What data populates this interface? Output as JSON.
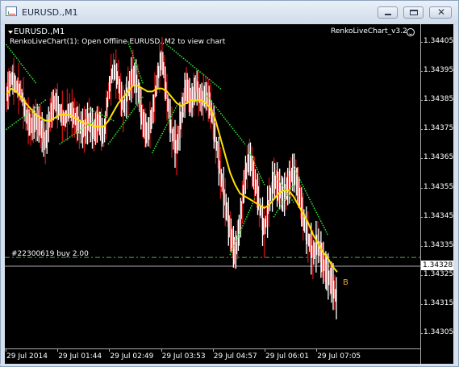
{
  "window": {
    "title": "EURUSD.,M1",
    "icon": "chart-window-icon",
    "controls": [
      "minimize-icon",
      "maximize-icon",
      "close-icon"
    ]
  },
  "chart_overlay": {
    "symbol_label": "EURUSD.,M1",
    "info_text": "RenkoLiveChart(1): Open Offline EURUSD.,M2 to view chart",
    "indicator_name": "RenkoLiveChart_v3.2",
    "order_label": "#22300619 buy 2.00",
    "trade_marker": "B",
    "current_price_tag": "1.34328"
  },
  "colors": {
    "background": "#000000",
    "bull_candle": "#ffffff",
    "bear_candle": "#cc1111",
    "moving_average": "#ffe000",
    "band_dots": "#33dd33",
    "order_line": "#55aa55",
    "current_price_line": "#aaaaaa",
    "trade_marker": "#e9a23b"
  },
  "chart_data": {
    "type": "line",
    "price_ticks": [
      "1.34405",
      "1.34395",
      "1.34385",
      "1.34375",
      "1.34365",
      "1.34355",
      "1.34345",
      "1.34335",
      "1.34325",
      "1.34315",
      "1.34305"
    ],
    "time_ticks": [
      "29 Jul 2014",
      "29 Jul 01:44",
      "29 Jul 02:49",
      "29 Jul 03:53",
      "29 Jul 04:57",
      "29 Jul 06:01",
      "29 Jul 07:05"
    ],
    "ylim": [
      1.34301,
      1.34408
    ],
    "order_price": 1.34331,
    "current_price": 1.34328,
    "series": [
      {
        "name": "Price",
        "values": [
          1.34386,
          1.34393,
          1.3439,
          1.34388,
          1.3438,
          1.34376,
          1.34378,
          1.34376,
          1.3437,
          1.3438,
          1.34385,
          1.34381,
          1.34378,
          1.34382,
          1.34379,
          1.34376,
          1.34375,
          1.34378,
          1.34374,
          1.34378,
          1.34372,
          1.34388,
          1.34396,
          1.34392,
          1.34382,
          1.34388,
          1.34394,
          1.3439,
          1.34378,
          1.34373,
          1.3438,
          1.34392,
          1.344,
          1.34386,
          1.34374,
          1.34368,
          1.3438,
          1.3439,
          1.34384,
          1.3439,
          1.34385,
          1.34387,
          1.34383,
          1.34372,
          1.3436,
          1.3435,
          1.3434,
          1.34332,
          1.34342,
          1.34358,
          1.34366,
          1.34358,
          1.3435,
          1.3434,
          1.3435,
          1.34358,
          1.34355,
          1.34352,
          1.34356,
          1.34361,
          1.34355,
          1.34345,
          1.34338,
          1.34332,
          1.34336,
          1.3433,
          1.34325,
          1.34322,
          1.34316
        ]
      },
      {
        "name": "MA",
        "values": [
          1.34387,
          1.34389,
          1.34388,
          1.34386,
          1.34384,
          1.34382,
          1.3438,
          1.34379,
          1.34378,
          1.34378,
          1.34379,
          1.3438,
          1.3438,
          1.3438,
          1.34379,
          1.34378,
          1.34377,
          1.34377,
          1.34376,
          1.34376,
          1.34376,
          1.34378,
          1.34381,
          1.34384,
          1.34386,
          1.34388,
          1.3439,
          1.3439,
          1.34389,
          1.34388,
          1.34388,
          1.34389,
          1.34389,
          1.34388,
          1.34386,
          1.34384,
          1.34383,
          1.34384,
          1.34385,
          1.34385,
          1.34385,
          1.34384,
          1.34382,
          1.34378,
          1.34372,
          1.34366,
          1.3436,
          1.34356,
          1.34353,
          1.34352,
          1.34351,
          1.3435,
          1.34349,
          1.34348,
          1.34349,
          1.34351,
          1.34353,
          1.34354,
          1.34354,
          1.34352,
          1.34349,
          1.34346,
          1.34343,
          1.34339,
          1.34336,
          1.34333,
          1.34331,
          1.34328,
          1.34326
        ]
      }
    ],
    "band_segments": [
      [
        [
          0,
          1.34404
        ],
        [
          6,
          1.34391
        ]
      ],
      [
        [
          0,
          1.34375
        ],
        [
          8,
          1.34385
        ]
      ],
      [
        [
          11,
          1.3437
        ],
        [
          18,
          1.34378
        ]
      ],
      [
        [
          17,
          1.34382
        ],
        [
          22,
          1.34378
        ]
      ],
      [
        [
          21,
          1.3437
        ],
        [
          28,
          1.34386
        ]
      ],
      [
        [
          25,
          1.34405
        ],
        [
          28,
          1.34391
        ]
      ],
      [
        [
          30,
          1.34367
        ],
        [
          35,
          1.34383
        ]
      ],
      [
        [
          33,
          1.34404
        ],
        [
          44,
          1.34389
        ]
      ],
      [
        [
          41,
          1.34387
        ],
        [
          49,
          1.3437
        ]
      ],
      [
        [
          46,
          1.34332
        ],
        [
          51,
          1.34351
        ]
      ],
      [
        [
          50,
          1.34367
        ],
        [
          53,
          1.34356
        ]
      ],
      [
        [
          55,
          1.3436
        ],
        [
          59,
          1.3435
        ]
      ],
      [
        [
          55,
          1.34345
        ],
        [
          59,
          1.34356
        ]
      ],
      [
        [
          59,
          1.34362
        ],
        [
          66,
          1.34339
        ]
      ]
    ]
  }
}
